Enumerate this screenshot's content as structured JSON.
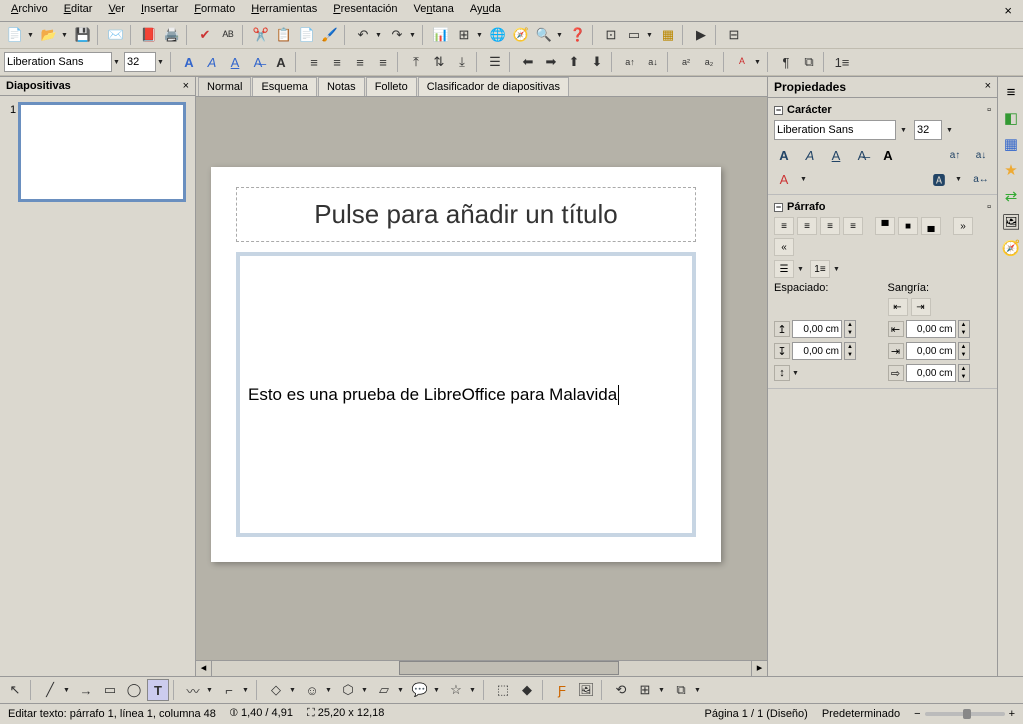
{
  "menu": {
    "archivo": "Archivo",
    "editar": "Editar",
    "ver": "Ver",
    "insertar": "Insertar",
    "formato": "Formato",
    "herramientas": "Herramientas",
    "presentacion": "Presentación",
    "ventana": "Ventana",
    "ayuda": "Ayuda"
  },
  "font": {
    "name": "Liberation Sans",
    "size": "32"
  },
  "slides": {
    "title": "Diapositivas",
    "num": "1"
  },
  "views": {
    "normal": "Normal",
    "esquema": "Esquema",
    "notas": "Notas",
    "folleto": "Folleto",
    "clasif": "Clasificador de diapositivas"
  },
  "slide": {
    "titlePlaceholder": "Pulse para añadir un título",
    "content": "Esto es una prueba de LibreOffice para Malavida"
  },
  "props": {
    "title": "Propiedades",
    "caracter": "Carácter",
    "parrafo": "Párrafo",
    "espaciado": "Espaciado:",
    "sangria": "Sangría:",
    "font": "Liberation Sans",
    "size": "32",
    "zero": "0,00 cm"
  },
  "status": {
    "edit": "Editar texto: párrafo 1, línea 1, columna 48",
    "cursor": "1,40 / 4,91",
    "pos": "25,20 x 12,18",
    "page": "Página 1 / 1 (Diseño)",
    "style": "Predeterminado"
  }
}
